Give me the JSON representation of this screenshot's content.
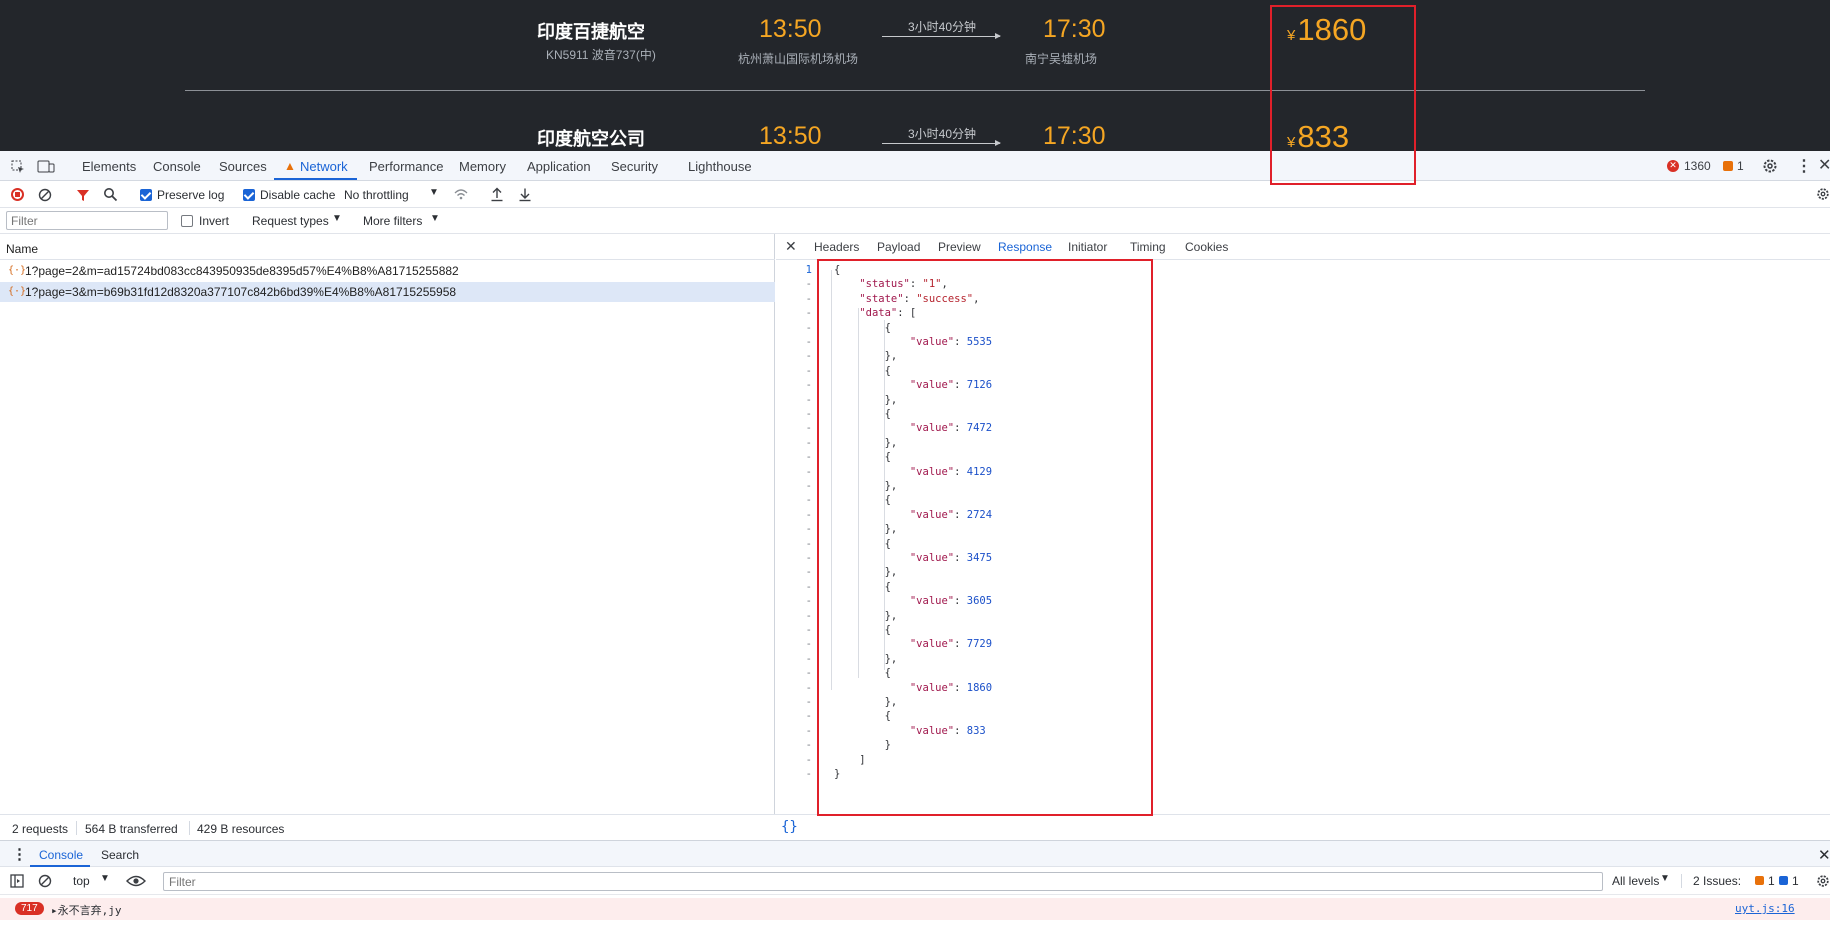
{
  "flights": [
    {
      "airline": "印度百捷航空",
      "flight_info": "KN5911 波音737(中)",
      "dep_time": "13:50",
      "dep_airport": "杭州萧山国际机场机场",
      "duration": "3小时40分钟",
      "arr_time": "17:30",
      "arr_airport": "南宁吴墟机场",
      "currency": "¥",
      "price": "1860"
    },
    {
      "airline": "印度航空公司",
      "dep_time": "13:50",
      "duration": "3小时40分钟",
      "arr_time": "17:30",
      "currency": "¥",
      "price": "833"
    }
  ],
  "devtools": {
    "tabs": [
      "Elements",
      "Console",
      "Sources",
      "Network",
      "Performance",
      "Memory",
      "Application",
      "Security",
      "Lighthouse"
    ],
    "error_count": "1360",
    "warning_count": "1",
    "toolbar": {
      "preserve_log": "Preserve log",
      "disable_cache": "Disable cache",
      "throttling": "No throttling"
    },
    "filter": {
      "placeholder": "Filter",
      "invert": "Invert",
      "request_types": "Request types",
      "more_filters": "More filters"
    },
    "name_header": "Name",
    "requests": [
      "1?page=2&m=ad15724bd083cc843950935de8395d57%E4%B8%A81715255882",
      "1?page=3&m=b69b31fd12d8320a377107c842b6bd39%E4%B8%A81715255958"
    ],
    "detail_tabs": [
      "Headers",
      "Payload",
      "Preview",
      "Response",
      "Initiator",
      "Timing",
      "Cookies"
    ],
    "response": {
      "status_key": "\"status\"",
      "status_val": "\"1\"",
      "state_key": "\"state\"",
      "state_val": "\"success\"",
      "data_key": "\"data\"",
      "value_key": "\"value\"",
      "values": [
        "5535",
        "7126",
        "7472",
        "4129",
        "2724",
        "3475",
        "3605",
        "7729",
        "1860",
        "833"
      ]
    },
    "status": {
      "requests": "2 requests",
      "transferred": "564 B transferred",
      "resources": "429 B resources"
    },
    "drawer": {
      "console_tab": "Console",
      "search_tab": "Search",
      "context": "top",
      "filter_placeholder": "Filter",
      "levels": "All levels",
      "issues_label": "2 Issues:",
      "issues_warn": "1",
      "issues_info": "1"
    },
    "console_message": {
      "count": "717",
      "text": "▸永不言弃,jy",
      "source": "uyt.js:16"
    }
  }
}
